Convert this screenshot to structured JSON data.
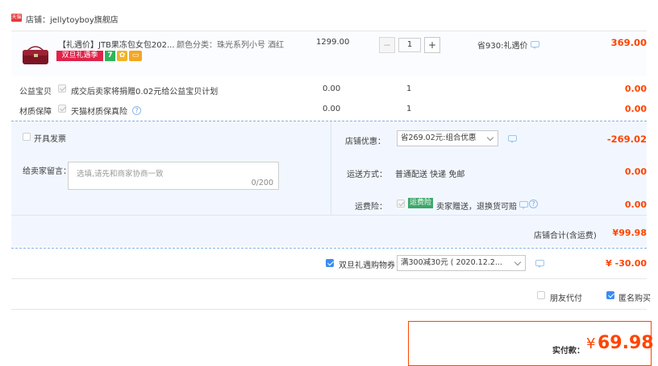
{
  "shop": {
    "badge_icon": "shop-icon",
    "name": "店铺：jellytoyboy旗舰店"
  },
  "item": {
    "title": "【礼遇价】JTB果冻包女包202...",
    "sku": "颜色分类：珠光系列小号 酒红",
    "price": "1299.00",
    "quantity": "1",
    "minus_label": "−",
    "plus_label": "+",
    "saving": "省930:礼遇价",
    "subtotal": "369.00",
    "promo_tag": "双旦礼遇季",
    "promo_tag_color": "#e0234a"
  },
  "addons": [
    {
      "label": "公益宝贝",
      "desc": "成交后卖家将捐赠0.02元给公益宝贝计划",
      "price": "0.00",
      "qty": "1",
      "total": "0.00"
    },
    {
      "label": "材质保障",
      "desc": "天猫材质保真险",
      "price": "0.00",
      "qty": "1",
      "total": "0.00"
    }
  ],
  "invoice": {
    "label": "开具发票"
  },
  "message": {
    "label": "给卖家留言：",
    "placeholder": "选填,请先和商家协商一致",
    "counter": "0/200"
  },
  "discount": {
    "label": "店铺优惠：",
    "value": "省269.02元:组合优惠",
    "amount": "-269.02"
  },
  "delivery": {
    "label": "运送方式：",
    "value": "普通配送 快递 免邮",
    "amount": "0.00"
  },
  "insurance": {
    "label": "运费险：",
    "badge": "运费险",
    "value": "卖家赠送，退换货可赔",
    "amount": "0.00"
  },
  "shop_total": {
    "label": "店铺合计(含运费)",
    "amount": "¥99.98"
  },
  "coupon": {
    "label": "双旦礼遇购物券",
    "value": "满300减30元 ( 2020.12.2...",
    "amount": "¥ -30.00"
  },
  "options": {
    "friend_pay": "朋友代付",
    "anonymous": "匿名购买"
  },
  "pay": {
    "label": "实付款：",
    "currency": "¥",
    "amount": "69.98"
  },
  "colors": {
    "accent": "#ff4400",
    "blue": "#3b8cf3",
    "section_bg": "#f2f7ff",
    "item_bg": "#fbfcff"
  }
}
